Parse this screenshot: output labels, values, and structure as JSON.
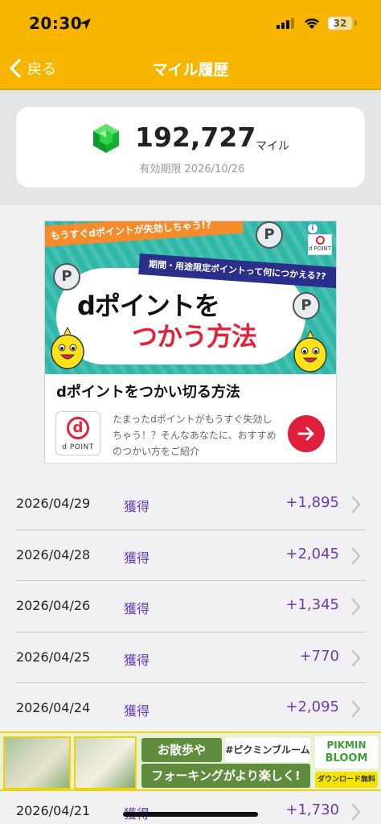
{
  "status_bar": {
    "time": "20:30",
    "battery": "32",
    "battery_level": 0.32
  },
  "nav": {
    "back_label": "戻る",
    "title": "マイル履歴"
  },
  "summary": {
    "balance": "192,727",
    "unit": "マイル",
    "expiry_label": "有効期限",
    "expiry_date": "2026/10/26"
  },
  "ad": {
    "ribbon_top": "もうすぐdポイントが失効しちゃう!?",
    "ribbon_mid": "期間・用途限定ポイントって何につかえる??",
    "headline_line1": "dポイントを",
    "headline_line2": "つかう方法",
    "badge_text": "P",
    "info_label": "i",
    "small_logo_text": "d POINT",
    "title": "dポイントをつかい切る方法",
    "logo_letter": "d",
    "logo_text": "d POINT",
    "description": "たまったdポイントがもうすぐ失効しちゃう！？そんなあなたに、おすすめのつかい方をご紹介"
  },
  "history": [
    {
      "date": "2026/04/29",
      "type": "獲得",
      "amount": "+1,895"
    },
    {
      "date": "2026/04/28",
      "type": "獲得",
      "amount": "+2,045"
    },
    {
      "date": "2026/04/26",
      "type": "獲得",
      "amount": "+1,345"
    },
    {
      "date": "2026/04/25",
      "type": "獲得",
      "amount": "+770"
    },
    {
      "date": "2026/04/24",
      "type": "獲得",
      "amount": "+2,095"
    },
    {
      "date": "",
      "type": "",
      "amount": ""
    },
    {
      "date": "2026/04/21",
      "type": "獲得",
      "amount": "+1,730"
    }
  ],
  "bottom_ad": {
    "line1": "お散歩や",
    "hashtag": "#ピクミンブルーム",
    "line2": "フォーキングがより楽しく!",
    "logo_line1": "PIKMIN",
    "logo_line2": "BLOOM",
    "download": "ダウンロード無料"
  },
  "colors": {
    "header": "#f7b500",
    "accent_purple": "#6b3ab2",
    "cta_red": "#e11d3c",
    "gem_green": "#1fbf3c"
  }
}
